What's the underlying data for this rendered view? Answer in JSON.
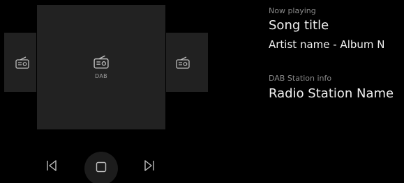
{
  "now_playing": {
    "label": "Now playing",
    "song_title": "Song title",
    "artist_album": "Artist name - Album N"
  },
  "station": {
    "label": "DAB Station info",
    "name": "Radio Station Name"
  },
  "carousel": {
    "center_label": "DAB",
    "icon": "radio-icon"
  },
  "controls": {
    "previous_icon": "skip-previous-icon",
    "stop_icon": "stop-icon",
    "next_icon": "skip-next-icon"
  },
  "colors": {
    "background": "#000000",
    "tile": "#222222",
    "primary_text": "#f0f0f0",
    "secondary_text": "#8a8a8a"
  }
}
